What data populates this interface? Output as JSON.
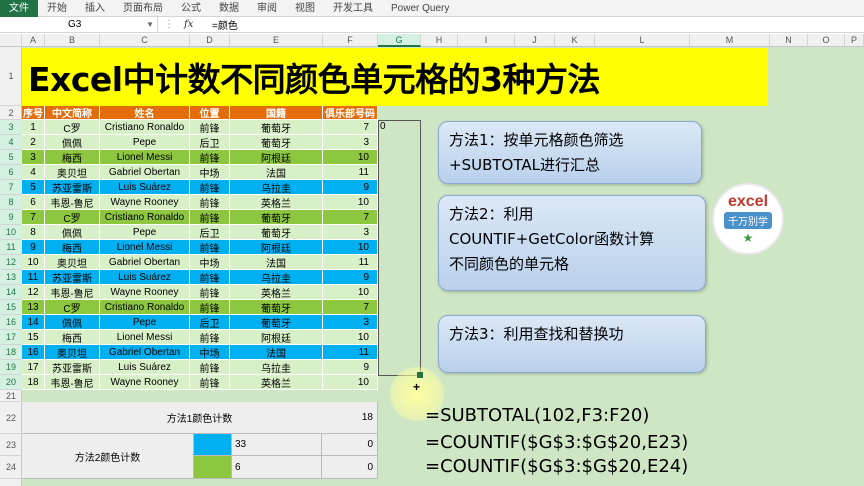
{
  "ribbon": {
    "tabs": [
      "文件",
      "开始",
      "插入",
      "页面布局",
      "公式",
      "数据",
      "审阅",
      "视图",
      "开发工具",
      "Power Query"
    ]
  },
  "formula_bar": {
    "name_box": "G3",
    "fx": "fx",
    "formula": "=颜色"
  },
  "columns": [
    "A",
    "B",
    "C",
    "D",
    "E",
    "F",
    "G",
    "H",
    "I",
    "J",
    "K",
    "L",
    "M",
    "N",
    "O",
    "P"
  ],
  "rows": [
    "1",
    "2",
    "3",
    "4",
    "5",
    "6",
    "7",
    "8",
    "9",
    "10",
    "11",
    "12",
    "13",
    "14",
    "15",
    "16",
    "17",
    "18",
    "19",
    "20",
    "21",
    "22",
    "23",
    "24"
  ],
  "title": "Excel中计数不同颜色单元格的3种方法",
  "table": {
    "headers": [
      "序号",
      "中文简称",
      "姓名",
      "位置",
      "国籍",
      "俱乐部号码"
    ],
    "rows": [
      {
        "no": "1",
        "cn": "C罗",
        "name": "Cristiano Ronaldo",
        "pos": "前锋",
        "nat": "葡萄牙",
        "num": "7",
        "color": "#d8f0c8"
      },
      {
        "no": "2",
        "cn": "佩佩",
        "name": "Pepe",
        "pos": "后卫",
        "nat": "葡萄牙",
        "num": "3",
        "color": "#d8f0c8"
      },
      {
        "no": "3",
        "cn": "梅西",
        "name": "Lionel Messi",
        "pos": "前锋",
        "nat": "阿根廷",
        "num": "10",
        "color": "#8dc63f"
      },
      {
        "no": "4",
        "cn": "奥贝坦",
        "name": "Gabriel Obertan",
        "pos": "中场",
        "nat": "法国",
        "num": "11",
        "color": "#d8f0c8"
      },
      {
        "no": "5",
        "cn": "苏亚雷斯",
        "name": "Luis Suárez",
        "pos": "前锋",
        "nat": "乌拉圭",
        "num": "9",
        "color": "#00b0f0"
      },
      {
        "no": "6",
        "cn": "韦恩-鲁尼",
        "name": "Wayne Rooney",
        "pos": "前锋",
        "nat": "英格兰",
        "num": "10",
        "color": "#d8f0c8"
      },
      {
        "no": "7",
        "cn": "C罗",
        "name": "Cristiano Ronaldo",
        "pos": "前锋",
        "nat": "葡萄牙",
        "num": "7",
        "color": "#8dc63f"
      },
      {
        "no": "8",
        "cn": "佩佩",
        "name": "Pepe",
        "pos": "后卫",
        "nat": "葡萄牙",
        "num": "3",
        "color": "#d8f0c8"
      },
      {
        "no": "9",
        "cn": "梅西",
        "name": "Lionel Messi",
        "pos": "前锋",
        "nat": "阿根廷",
        "num": "10",
        "color": "#00b0f0"
      },
      {
        "no": "10",
        "cn": "奥贝坦",
        "name": "Gabriel Obertan",
        "pos": "中场",
        "nat": "法国",
        "num": "11",
        "color": "#d8f0c8"
      },
      {
        "no": "11",
        "cn": "苏亚雷斯",
        "name": "Luis Suárez",
        "pos": "前锋",
        "nat": "乌拉圭",
        "num": "9",
        "color": "#00b0f0"
      },
      {
        "no": "12",
        "cn": "韦恩-鲁尼",
        "name": "Wayne Rooney",
        "pos": "前锋",
        "nat": "英格兰",
        "num": "10",
        "color": "#d8f0c8"
      },
      {
        "no": "13",
        "cn": "C罗",
        "name": "Cristiano Ronaldo",
        "pos": "前锋",
        "nat": "葡萄牙",
        "num": "7",
        "color": "#8dc63f"
      },
      {
        "no": "14",
        "cn": "佩佩",
        "name": "Pepe",
        "pos": "后卫",
        "nat": "葡萄牙",
        "num": "3",
        "color": "#00b0f0"
      },
      {
        "no": "15",
        "cn": "梅西",
        "name": "Lionel Messi",
        "pos": "前锋",
        "nat": "阿根廷",
        "num": "10",
        "color": "#d8f0c8"
      },
      {
        "no": "16",
        "cn": "奥贝坦",
        "name": "Gabriel Obertan",
        "pos": "中场",
        "nat": "法国",
        "num": "11",
        "color": "#00b0f0"
      },
      {
        "no": "17",
        "cn": "苏亚雷斯",
        "name": "Luis Suárez",
        "pos": "前锋",
        "nat": "乌拉圭",
        "num": "9",
        "color": "#d8f0c8"
      },
      {
        "no": "18",
        "cn": "韦恩-鲁尼",
        "name": "Wayne Rooney",
        "pos": "前锋",
        "nat": "英格兰",
        "num": "10",
        "color": "#d8f0c8"
      }
    ]
  },
  "g3_value": "0",
  "methods": {
    "m1": {
      "line1": "方法1：按单元格颜色筛选",
      "line2": "+SUBTOTAL进行汇总"
    },
    "m2": {
      "line1": "方法2：利用",
      "line2": "COUNTIF+GetColor函数计算",
      "line3": "不同颜色的单元格"
    },
    "m3": {
      "line1": "方法3：利用查找和替换功"
    }
  },
  "logo": {
    "word": "excel",
    "sub": "千万别学"
  },
  "summary": {
    "method1_label": "方法1颜色计数",
    "method1_value": "18",
    "method2_label": "方法2颜色计数",
    "row23_color": "#00b0f0",
    "row23_code": "33",
    "row23_value": "0",
    "row24_color": "#8dc63f",
    "row24_code": "6",
    "row24_value": "0"
  },
  "formulas": {
    "f1": "=SUBTOTAL(102,F3:F20)",
    "f2": "=COUNTIF($G$3:$G$20,E23)",
    "f3": "=COUNTIF($G$3:$G$20,E24)"
  }
}
